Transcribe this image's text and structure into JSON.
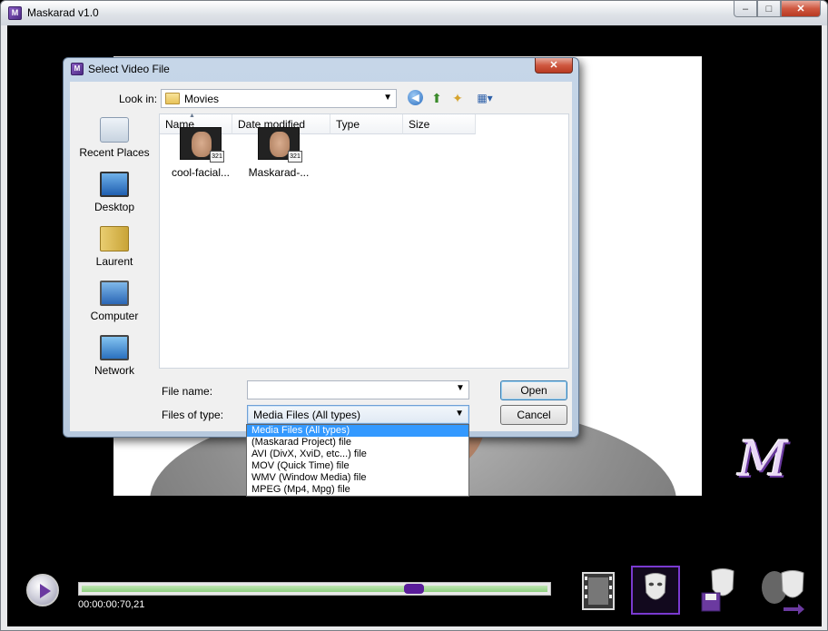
{
  "app": {
    "title": "Maskarad v1.0",
    "icon": "maskarad-app-icon",
    "window_buttons": {
      "minimize": "–",
      "maximize": "□",
      "close": "✕"
    },
    "logo_text": "M"
  },
  "player": {
    "timecode": "00:00:00:70,21",
    "progress_fraction": 0.72,
    "accent_color": "#5a1d9a",
    "tools": [
      "film-icon",
      "face-mask-icon",
      "save-mask-icon",
      "export-masks-icon"
    ]
  },
  "dialog": {
    "title": "Select Video File",
    "close_glyph": "✕",
    "look_in_label": "Look in:",
    "look_in_value": "Movies",
    "places": [
      {
        "label": "Recent Places",
        "icon": "recent-places-icon"
      },
      {
        "label": "Desktop",
        "icon": "desktop-icon"
      },
      {
        "label": "Laurent",
        "icon": "user-folder-icon"
      },
      {
        "label": "Computer",
        "icon": "computer-icon"
      },
      {
        "label": "Network",
        "icon": "network-icon"
      }
    ],
    "columns": [
      "Name",
      "Date modified",
      "Type",
      "Size"
    ],
    "files": [
      {
        "name": "cool-facial...",
        "icon": "video-thumbnail-icon",
        "badge": "321"
      },
      {
        "name": "Maskarad-...",
        "icon": "video-thumbnail-icon",
        "badge": "321"
      }
    ],
    "file_name_label": "File name:",
    "file_name_value": "",
    "files_of_type_label": "Files of type:",
    "files_of_type_value": "Media Files (All types)",
    "open_label": "Open",
    "cancel_label": "Cancel",
    "type_options": [
      "Media Files (All types)",
      "(Maskarad Project) file",
      "AVI (DivX, XviD, etc...) file",
      "MOV (Quick Time) file",
      "WMV (Window Media) file",
      "MPEG (Mp4, Mpg) file"
    ],
    "selected_option_index": 0
  }
}
